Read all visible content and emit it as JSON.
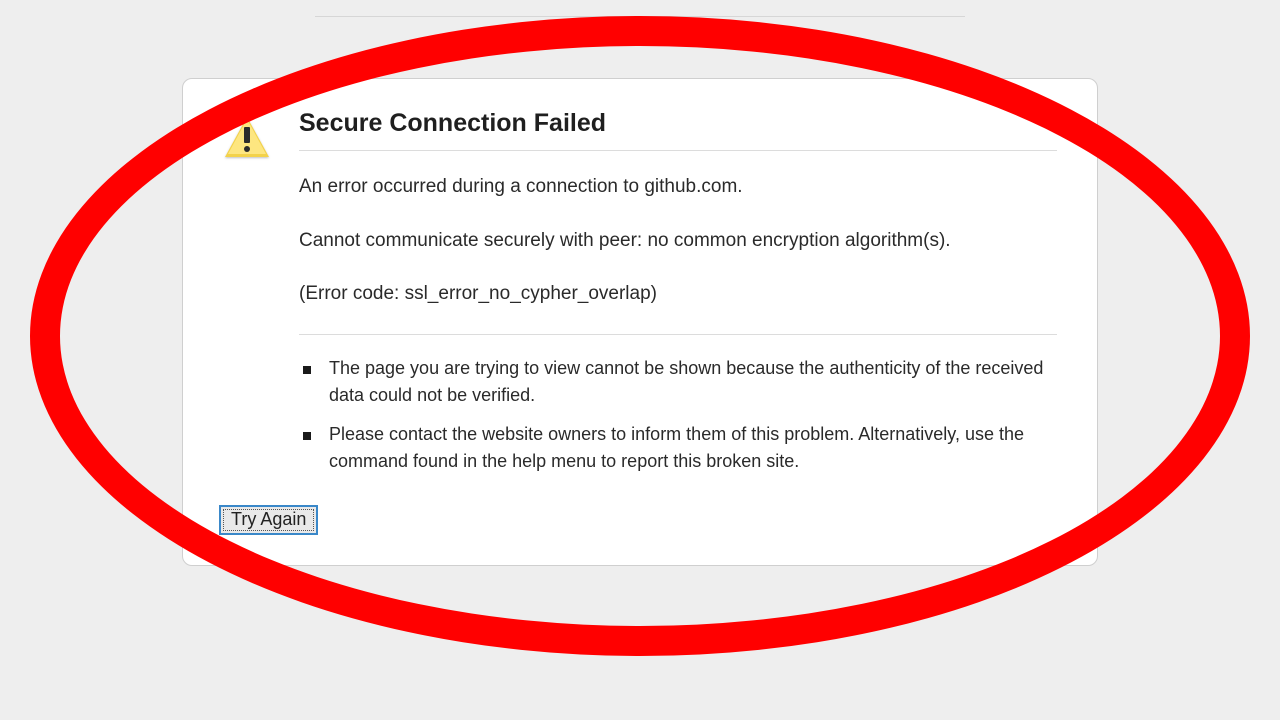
{
  "error": {
    "title": "Secure Connection Failed",
    "intro": "An error occurred during a connection to github.com.",
    "detail": "Cannot communicate securely with peer: no common encryption algorithm(s).",
    "code": "(Error code: ssl_error_no_cypher_overlap)",
    "bullets": [
      "The page you are trying to view cannot be shown because the authenticity of the received data could not be verified.",
      "Please contact the website owners to inform them of this problem. Alternatively, use the command found in the help menu to report this broken site."
    ]
  },
  "buttons": {
    "try_again": "Try Again"
  }
}
